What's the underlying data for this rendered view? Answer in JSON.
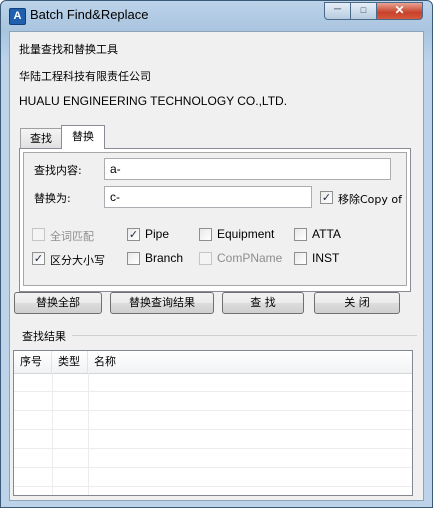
{
  "window": {
    "title": "Batch Find&Replace",
    "icon": "app-logo-icon",
    "controls": {
      "minimize": "minimize-icon",
      "maximize": "maximize-icon",
      "close": "close-icon"
    }
  },
  "info": {
    "line1": "批量查找和替换工具",
    "line2": "华陆工程科技有限责任公司",
    "line3": "HUALU ENGINEERING TECHNOLOGY CO.,LTD."
  },
  "tabs": [
    {
      "label": "查找",
      "active": false
    },
    {
      "label": "替换",
      "active": true
    }
  ],
  "form": {
    "find_label": "查找内容:",
    "find_value": "a-",
    "replace_label": "替换为:",
    "replace_value": "c-",
    "remove_copy": {
      "label": "移除Copy of",
      "checked": true
    }
  },
  "options": [
    {
      "label": "全词匹配",
      "checked": false,
      "enabled": false
    },
    {
      "label": "Pipe",
      "checked": true,
      "enabled": true
    },
    {
      "label": "Equipment",
      "checked": false,
      "enabled": true
    },
    {
      "label": "ATTA",
      "checked": false,
      "enabled": true
    },
    {
      "label": "区分大小写",
      "checked": true,
      "enabled": true
    },
    {
      "label": "Branch",
      "checked": false,
      "enabled": true
    },
    {
      "label": "ComPName",
      "checked": false,
      "enabled": false
    },
    {
      "label": "INST",
      "checked": false,
      "enabled": true
    }
  ],
  "buttons": {
    "replace_all": "替换全部",
    "replace_results": "替换查询结果",
    "find": "查  找",
    "close": "关  闭"
  },
  "results": {
    "title": "查找结果",
    "columns": [
      "序号",
      "类型",
      "名称"
    ],
    "rows": []
  }
}
